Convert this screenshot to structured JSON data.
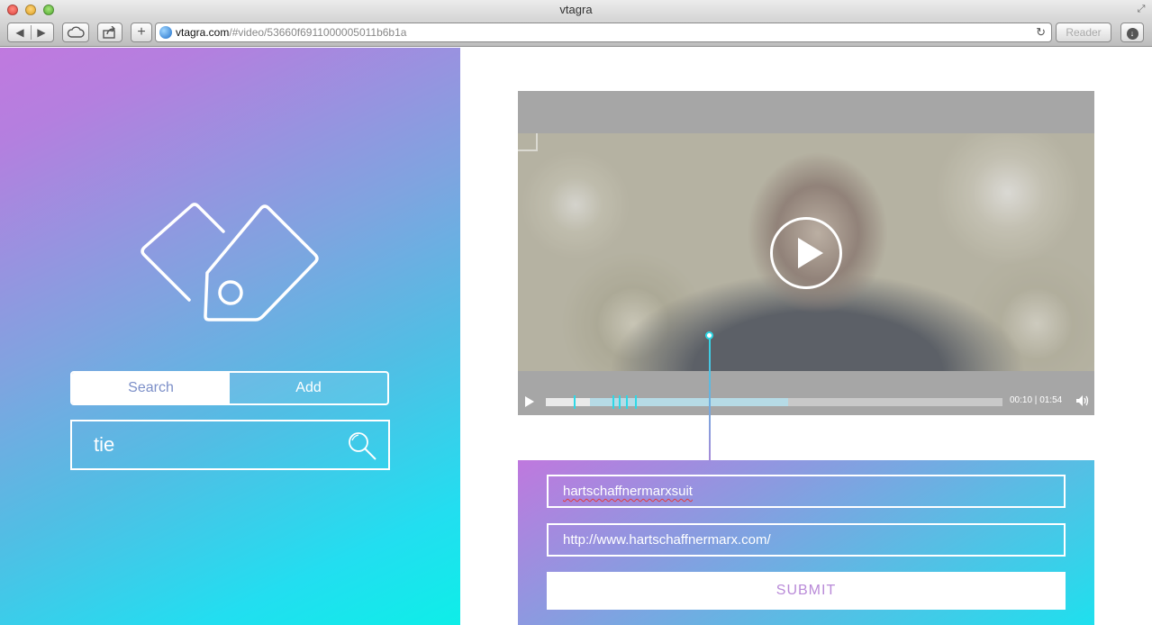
{
  "window": {
    "title": "vtagra"
  },
  "toolbar": {
    "url_host": "vtagra.com",
    "url_path": "/#video/53660f6911000005011b6b1a",
    "reader_label": "Reader",
    "plus_label": "+",
    "back_glyph": "◀",
    "forward_glyph": "▶",
    "reload_glyph": "↻"
  },
  "sidebar": {
    "tabs": [
      {
        "label": "Search",
        "active": true
      },
      {
        "label": "Add",
        "active": false
      }
    ],
    "search": {
      "value": "tie"
    }
  },
  "video": {
    "time_current": "00:10",
    "time_total": "01:54",
    "progress_played": 0.096,
    "progress_buffered": 0.53,
    "tag_markers": [
      0.062,
      0.145,
      0.16,
      0.175,
      0.195
    ]
  },
  "tag_form": {
    "name_value": "hartschaffnermarxsuit",
    "url_value": "http://www.hartschaffnermarx.com/",
    "submit_label": "SUBMIT"
  },
  "colors": {
    "accent_cyan": "#2ed8e6",
    "accent_purple": "#bf78de"
  }
}
